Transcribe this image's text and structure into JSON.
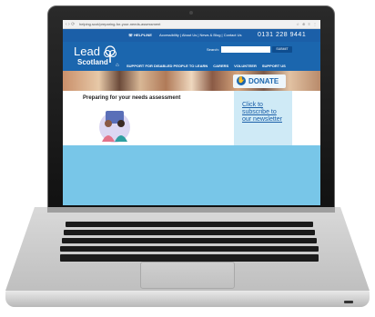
{
  "browser": {
    "url": "helping.scot/preparing-for-your-needs-assessment",
    "tools": "☆ ⊕ ≡ ⋮"
  },
  "site": {
    "helpline": "HELPLINE",
    "top_links": "Accessibility | About Us | News & Blog | Contact Us",
    "phone": "0131 228 9441",
    "logo_line1": "Lead",
    "logo_line2": "Scotland",
    "search_label": "Search:",
    "search_placeholder": "",
    "search_button": "SUBMIT",
    "nav": [
      "SUPPORT FOR DISABLED PEOPLE TO LEARN",
      "CARERS",
      "VOLUNTEER",
      "SUPPORT US"
    ],
    "donate_label": "DONATE",
    "page_title": "Preparing for your needs assessment",
    "newsletter_link": "Click to subscribe to our newsletter"
  },
  "colors": {
    "brand_blue": "#1b66ae",
    "page_background": "#78c6e8",
    "newsletter_panel": "#cfeaf6"
  },
  "icons": {
    "helpline": "phone-icon",
    "home": "home-icon",
    "donate": "hand-icon",
    "logo": "tree-icon"
  }
}
